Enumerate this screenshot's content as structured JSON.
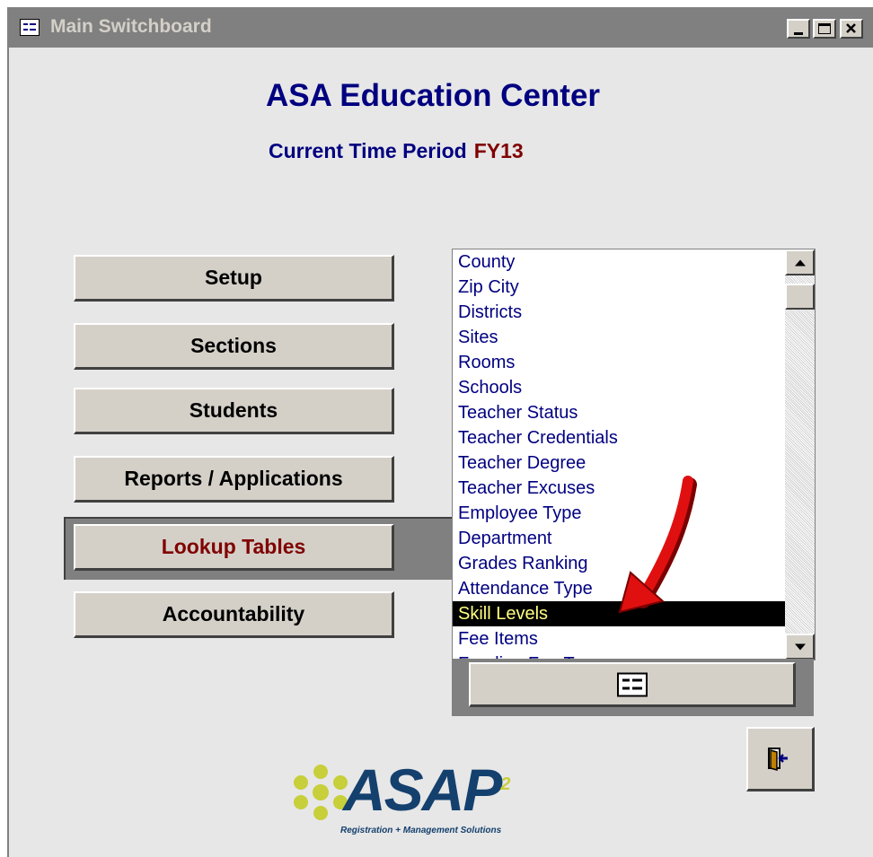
{
  "window": {
    "title": "Main Switchboard"
  },
  "header": {
    "app_title": "ASA Education Center",
    "period_label": "Current Time Period",
    "period_value": "FY13"
  },
  "nav": [
    {
      "label": "Setup"
    },
    {
      "label": "Sections"
    },
    {
      "label": "Students"
    },
    {
      "label": "Reports / Applications"
    },
    {
      "label": "Lookup Tables",
      "active": true
    },
    {
      "label": "Accountability"
    }
  ],
  "lookup_list": {
    "items": [
      "County",
      "Zip City",
      "Districts",
      "Sites",
      "Rooms",
      "Schools",
      "Teacher Status",
      "Teacher Credentials",
      "Teacher Degree",
      "Teacher Excuses",
      "Employee Type",
      "Department",
      "Grades Ranking",
      "Attendance Type",
      "Skill Levels",
      "Fee Items",
      "Funding Fee Types"
    ],
    "selected": "Skill Levels"
  },
  "logo": {
    "text": "ASAP",
    "superscript": "2",
    "tagline": "Registration + Management Solutions"
  },
  "icons": {
    "window": "form-window-icon",
    "minimize": "minimize-icon",
    "maximize": "maximize-icon",
    "close": "close-icon",
    "open_form": "form-icon",
    "exit": "exit-door-icon",
    "annotation": "red-arrow"
  },
  "colors": {
    "title_text": "#000080",
    "period_value": "#800000",
    "active_nav": "#800000",
    "selected_bg": "#000000",
    "selected_fg": "#ffff80",
    "annotation_arrow": "#e01010"
  }
}
